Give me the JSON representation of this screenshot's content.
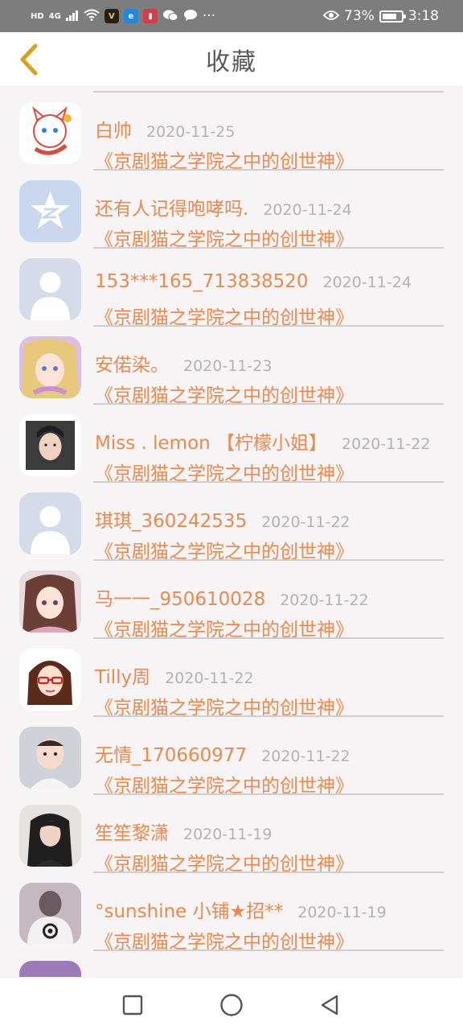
{
  "status_bar": {
    "hd": "HD",
    "network": "4G",
    "battery_percent": "73%",
    "time": "3:18",
    "more": "···"
  },
  "header": {
    "title": "收藏"
  },
  "favorites": [
    {
      "name": "白帅",
      "date": "2020-11-25",
      "work": "《京剧猫之学院之中的创世神》",
      "avatar": "cartoon-cat"
    },
    {
      "name": "还有人记得咆哮吗.",
      "date": "2020-11-24",
      "work": "《京剧猫之学院之中的创世神》",
      "avatar": "qzone-star"
    },
    {
      "name": "153***165_713838520",
      "date": "2020-11-24",
      "work": "《京剧猫之学院之中的创世神》",
      "avatar": "default-user"
    },
    {
      "name": "安偌染。",
      "date": "2020-11-23",
      "work": "《京剧猫之学院之中的创世神》",
      "avatar": "anime-girl-blonde"
    },
    {
      "name": "Miss . lemon 【柠檬小姐】",
      "date": "2020-11-22",
      "work": "《京剧猫之学院之中的创世神》",
      "avatar": "photo-girl"
    },
    {
      "name": "琪琪_360242535",
      "date": "2020-11-22",
      "work": "《京剧猫之学院之中的创世神》",
      "avatar": "default-user"
    },
    {
      "name": "马一一_950610028",
      "date": "2020-11-22",
      "work": "《京剧猫之学院之中的创世神》",
      "avatar": "anime-girl-brown"
    },
    {
      "name": "Tilly周",
      "date": "2020-11-22",
      "work": "《京剧猫之学院之中的创世神》",
      "avatar": "cartoon-glasses-girl"
    },
    {
      "name": "无情_170660977",
      "date": "2020-11-22",
      "work": "《京剧猫之学院之中的创世神》",
      "avatar": "photo-baby"
    },
    {
      "name": "笙笙黎潇",
      "date": "2020-11-19",
      "work": "《京剧猫之学院之中的创世神》",
      "avatar": "photo-dark-hair"
    },
    {
      "name": "°sunshine 小铺★招**",
      "date": "2020-11-19",
      "work": "《京剧猫之学院之中的创世神》",
      "avatar": "photo-hoodie"
    }
  ],
  "colors": {
    "accent": "#ea8a4f",
    "date_gray": "#b3b3b3",
    "back_arrow": "#d9a11a",
    "status_bar": "#7d7d7d"
  }
}
